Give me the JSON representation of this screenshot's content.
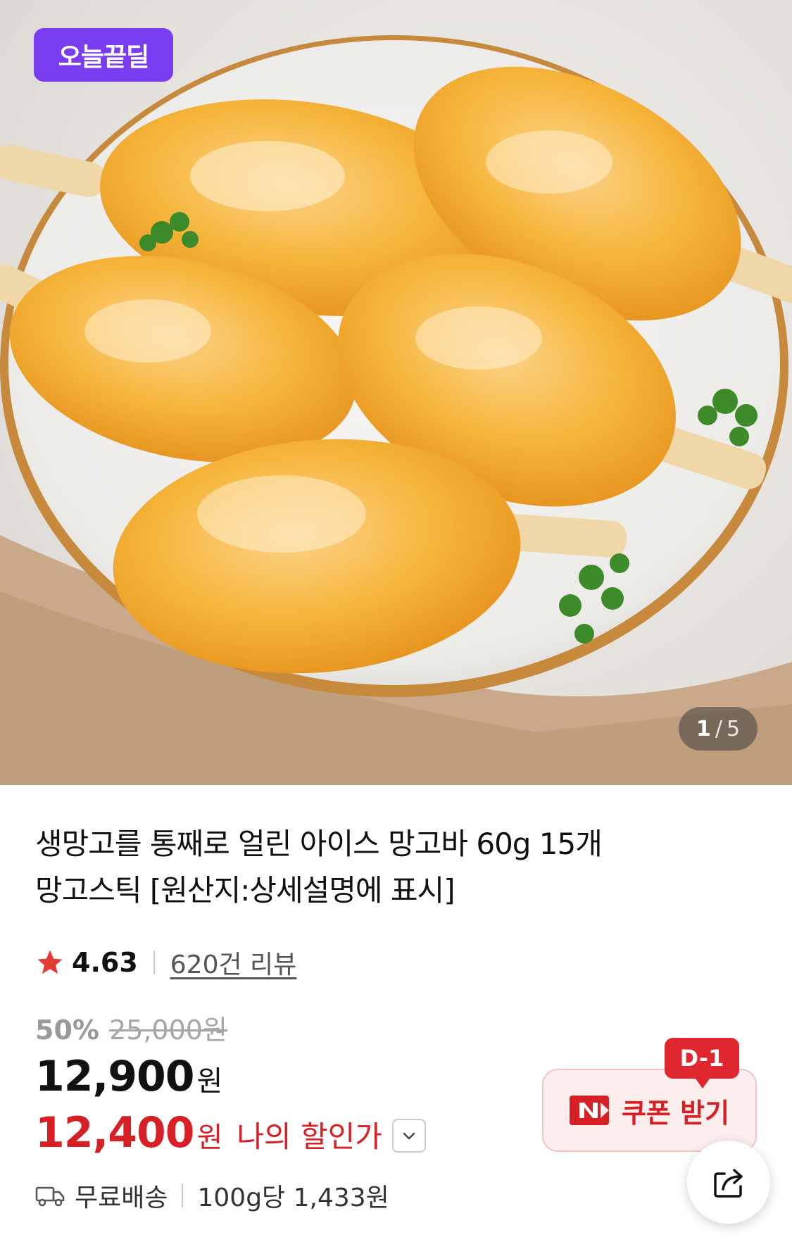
{
  "hero": {
    "badge": "오늘끝딜",
    "pager": {
      "current": "1",
      "separator": "/",
      "total": "5"
    }
  },
  "product": {
    "title_line1": "생망고를 통째로 얼린 아이스 망고바 60g 15개",
    "title_line2": "망고스틱 [원산지:상세설명에 표시]",
    "rating": {
      "score": "4.63",
      "reviews": "620건 리뷰",
      "star_color": "#e53935"
    },
    "discount_pct": "50%",
    "original_price": "25,000원",
    "price": {
      "number": "12,900",
      "unit": "원"
    },
    "my_price": {
      "number": "12,400",
      "unit": "원",
      "label": "나의 할인가",
      "color": "#d71f26"
    },
    "shipping": {
      "label": "무료배송",
      "unit_price": "100g당 1,433원"
    }
  },
  "coupon": {
    "badge": "D-1",
    "label": "쿠폰 받기",
    "icon": "naver-n-icon"
  },
  "share": {
    "icon": "share-icon"
  }
}
